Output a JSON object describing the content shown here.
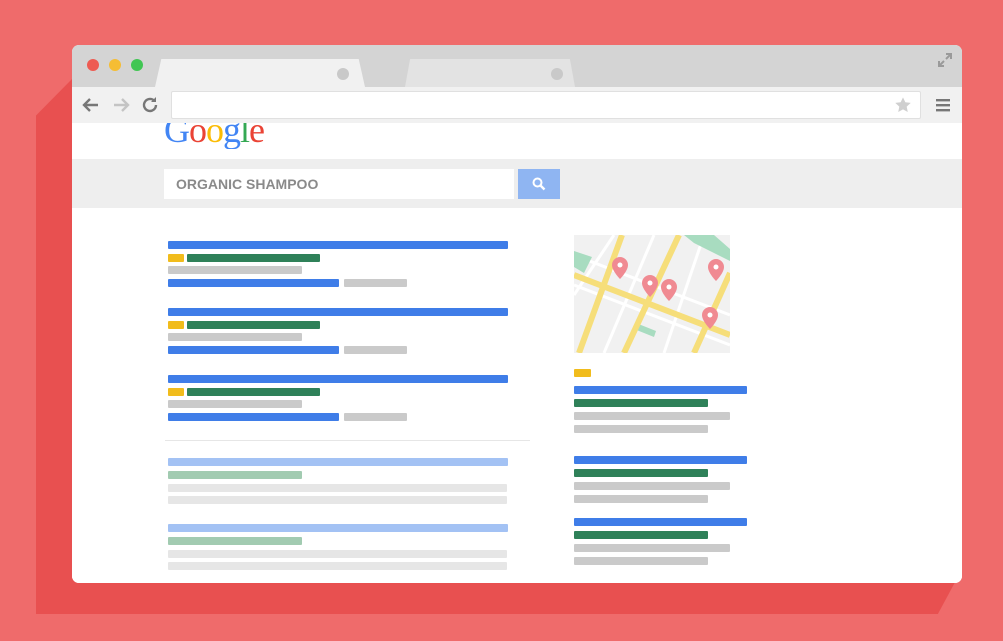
{
  "theme": {
    "background": "#ef6b6b",
    "shadow": "#e85050",
    "accent_blue": "#3f7de8",
    "accent_green": "#2f8159",
    "accent_yellow": "#f1bc1c"
  },
  "browser": {
    "window_controls": [
      "close",
      "minimize",
      "maximize"
    ],
    "tabs": [
      {
        "state": "active"
      },
      {
        "state": "inactive"
      }
    ],
    "toolbar": {
      "icons": [
        "back-arrow-icon",
        "forward-arrow-icon",
        "reload-icon",
        "star-icon",
        "menu-icon"
      ],
      "address_value": ""
    }
  },
  "page": {
    "logo": {
      "letters": [
        {
          "char": "G",
          "color": "#4285f4"
        },
        {
          "char": "o",
          "color": "#ea4335"
        },
        {
          "char": "o",
          "color": "#fbbc05"
        },
        {
          "char": "g",
          "color": "#4285f4"
        },
        {
          "char": "l",
          "color": "#34a853"
        },
        {
          "char": "e",
          "color": "#ea4335"
        }
      ]
    },
    "search": {
      "query": "ORGANIC SHAMPOO",
      "button_icon": "search-icon"
    },
    "results": {
      "ads_count": 3,
      "organic_count": 2
    },
    "local_pack": {
      "map_pins": 5,
      "listings_count": 3
    }
  }
}
